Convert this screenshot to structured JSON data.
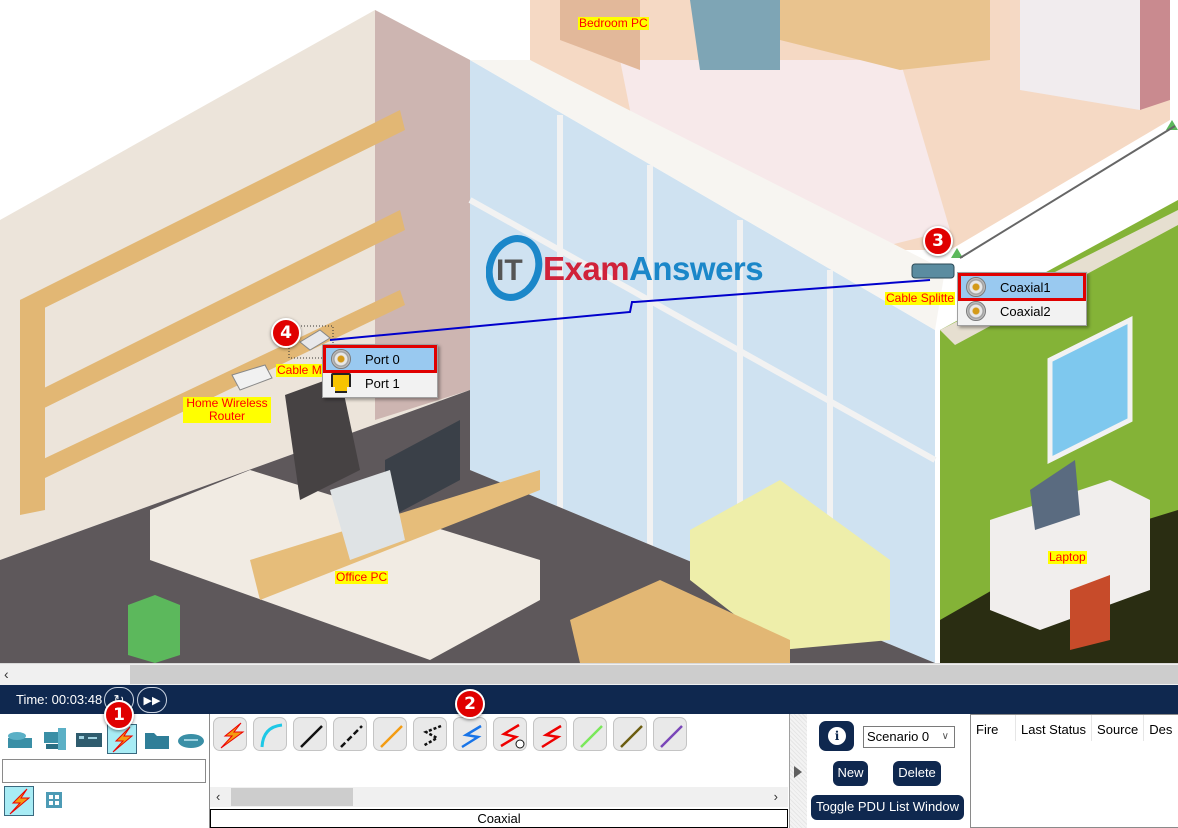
{
  "workspace": {
    "device_labels": {
      "bedroom_pc": "Bedroom PC",
      "cable_splitter": "Cable Splitte",
      "cable_modem": "Cable M",
      "home_wireless_router_line1": "Home Wireless",
      "home_wireless_router_line2": "Router",
      "office_pc": "Office PC",
      "laptop": "Laptop"
    },
    "watermark": {
      "it": "IT",
      "exam": "Exam",
      "answers": "Answers"
    },
    "badges": [
      "1",
      "2",
      "3",
      "4"
    ],
    "cable_modem_menu": [
      {
        "label": "Port 0",
        "icon": "coaxial-port-icon",
        "selected": true
      },
      {
        "label": "Port 1",
        "icon": "ethernet-port-icon",
        "selected": false
      }
    ],
    "cable_splitter_menu": [
      {
        "label": "Coaxial1",
        "icon": "coaxial-port-icon",
        "selected": true
      },
      {
        "label": "Coaxial2",
        "icon": "coaxial-port-icon",
        "selected": false
      }
    ],
    "link_color": "#0000cc"
  },
  "timebar": {
    "time_label": "Time: 00:03:48",
    "reset_icon": "reset-time-icon",
    "fast_forward_icon": "fast-forward-icon"
  },
  "device_panel": {
    "categories": [
      {
        "name": "network-devices",
        "icon": "router-switch-icon"
      },
      {
        "name": "end-devices",
        "icon": "pc-icon"
      },
      {
        "name": "components",
        "icon": "module-board-icon"
      },
      {
        "name": "connections",
        "icon": "lightning-icon",
        "active": true
      },
      {
        "name": "miscellaneous",
        "icon": "folder-icon"
      },
      {
        "name": "multiuser",
        "icon": "cloud-icon"
      }
    ],
    "search_value": "",
    "sub_categories": [
      {
        "name": "connections",
        "icon": "lightning-icon",
        "active": true
      },
      {
        "name": "grid",
        "icon": "grid-icon"
      }
    ]
  },
  "cable_panel": {
    "cables": [
      {
        "name": "automatic",
        "icon": "auto-connection-icon"
      },
      {
        "name": "console",
        "icon": "console-cable-icon"
      },
      {
        "name": "copper-straight-through",
        "icon": "straight-through-icon"
      },
      {
        "name": "copper-cross-over",
        "icon": "crossover-icon"
      },
      {
        "name": "fiber",
        "icon": "fiber-icon"
      },
      {
        "name": "phone",
        "icon": "phone-cable-icon"
      },
      {
        "name": "coaxial",
        "icon": "coaxial-cable-icon",
        "highlighted": true
      },
      {
        "name": "serial-dce",
        "icon": "serial-dce-icon"
      },
      {
        "name": "serial-dte",
        "icon": "serial-dte-icon"
      },
      {
        "name": "octal",
        "icon": "octal-cable-icon"
      },
      {
        "name": "iot-custom",
        "icon": "iot-cable-icon"
      },
      {
        "name": "usb",
        "icon": "usb-cable-icon"
      }
    ],
    "selected_cable_name": "Coaxial"
  },
  "scenario_panel": {
    "scenario_select": "Scenario 0",
    "new_label": "New",
    "delete_label": "Delete",
    "toggle_label": "Toggle PDU List Window"
  },
  "pdu_table": {
    "columns": [
      "Fire",
      "Last Status",
      "Source",
      "Des"
    ]
  }
}
